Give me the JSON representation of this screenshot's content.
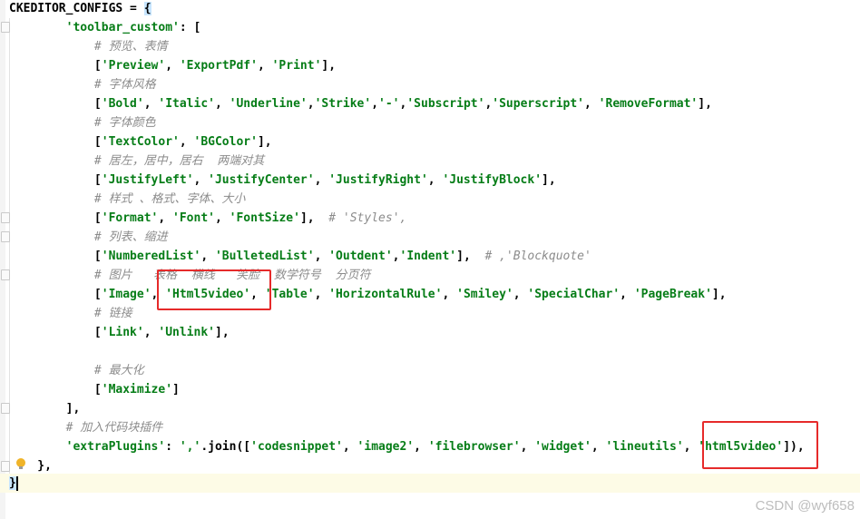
{
  "editor": {
    "lines": [
      {
        "t": "CKEDITOR_CONFIGS = {"
      },
      {
        "t": "        'toolbar_custom': ["
      },
      {
        "t": "            # 预览、表情"
      },
      {
        "t": "            ['Preview', 'ExportPdf', 'Print'],"
      },
      {
        "t": "            # 字体风格"
      },
      {
        "t": "            ['Bold', 'Italic', 'Underline','Strike','-','Subscript','Superscript', 'RemoveFormat'],"
      },
      {
        "t": "            # 字体颜色"
      },
      {
        "t": "            ['TextColor', 'BGColor'],"
      },
      {
        "t": "            # 居左，居中，居右  两端对其"
      },
      {
        "t": "            ['JustifyLeft', 'JustifyCenter', 'JustifyRight', 'JustifyBlock'],"
      },
      {
        "t": "            # 样式 、格式、字体、大小"
      },
      {
        "t": "            ['Format', 'Font', 'FontSize'],  # 'Styles',"
      },
      {
        "t": "            # 列表、缩进"
      },
      {
        "t": "            ['NumberedList', 'BulletedList', 'Outdent','Indent'],  # ,'Blockquote'"
      },
      {
        "t": "            # 图片   表格  横线   笑脸  数学符号  分页符"
      },
      {
        "t": "            ['Image', 'Html5video', 'Table', 'HorizontalRule', 'Smiley', 'SpecialChar', 'PageBreak'],"
      },
      {
        "t": "            # 链接"
      },
      {
        "t": "            ['Link', 'Unlink'],"
      },
      {
        "t": ""
      },
      {
        "t": "            # 最大化"
      },
      {
        "t": "            ['Maximize']"
      },
      {
        "t": "        ],"
      },
      {
        "t": "        # 加入代码块插件"
      },
      {
        "t": "        'extraPlugins': ','.join(['codesnippet', 'image2', 'filebrowser', 'widget', 'lineutils', 'html5video']),"
      },
      {
        "t": "    },"
      },
      {
        "t": "}"
      }
    ]
  },
  "watermark": "CSDN @wyf658",
  "colors": {
    "comment": "#8c8c8c",
    "string": "#067d17",
    "highlight_box": "#e62a2a",
    "current_line": "#fdfbe6"
  }
}
